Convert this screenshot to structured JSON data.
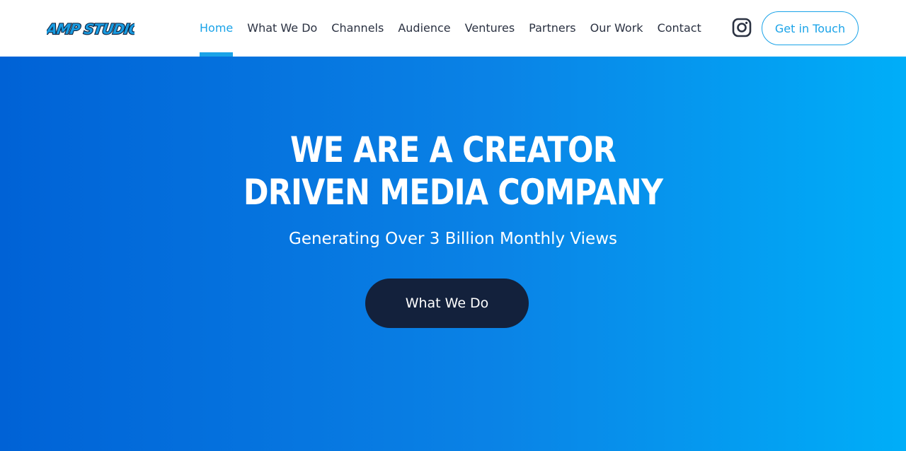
{
  "header": {
    "logo_text": "AMP STUDIOS",
    "nav": [
      {
        "label": "Home",
        "active": true
      },
      {
        "label": "What We Do",
        "active": false
      },
      {
        "label": "Channels",
        "active": false
      },
      {
        "label": "Audience",
        "active": false
      },
      {
        "label": "Ventures",
        "active": false
      },
      {
        "label": "Partners",
        "active": false
      },
      {
        "label": "Our Work",
        "active": false
      },
      {
        "label": "Contact",
        "active": false
      }
    ],
    "social_icon": "instagram-icon",
    "cta_label": "Get in Touch"
  },
  "hero": {
    "title_line1": "WE ARE A CREATOR",
    "title_line2": "DRIVEN MEDIA COMPANY",
    "subtitle": "Generating Over 3 Billion Monthly Views",
    "button_label": "What We Do"
  },
  "colors": {
    "accent": "#1aa3e8",
    "nav_text": "#2b3242",
    "hero_gradient_start": "#0062d6",
    "hero_gradient_end": "#00aef8",
    "button_dark": "#13213c"
  }
}
